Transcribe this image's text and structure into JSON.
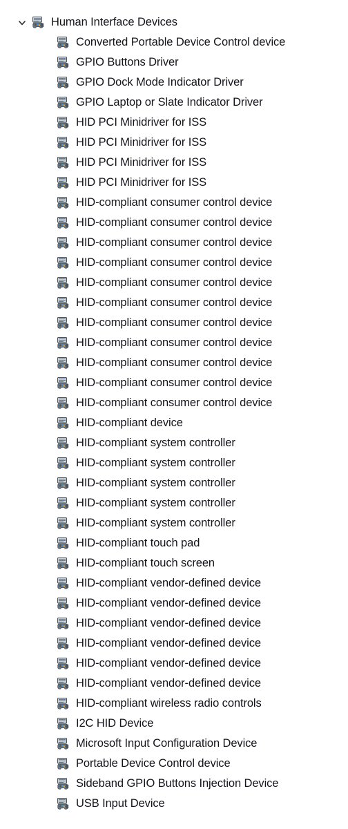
{
  "window": {
    "app": "Device Manager",
    "view": "device-tree"
  },
  "tree": {
    "root": {
      "label": "Human Interface Devices",
      "expand_state": "expanded",
      "chevron_icon": "chevron-down-icon",
      "node_icon": "hid-device-icon"
    },
    "child_icon": "hid-device-icon",
    "children": [
      {
        "label": "Converted Portable Device Control device"
      },
      {
        "label": "GPIO Buttons Driver"
      },
      {
        "label": "GPIO Dock Mode Indicator Driver"
      },
      {
        "label": "GPIO Laptop or Slate Indicator Driver"
      },
      {
        "label": "HID PCI Minidriver for ISS"
      },
      {
        "label": "HID PCI Minidriver for ISS"
      },
      {
        "label": "HID PCI Minidriver for ISS"
      },
      {
        "label": "HID PCI Minidriver for ISS"
      },
      {
        "label": "HID-compliant consumer control device"
      },
      {
        "label": "HID-compliant consumer control device"
      },
      {
        "label": "HID-compliant consumer control device"
      },
      {
        "label": "HID-compliant consumer control device"
      },
      {
        "label": "HID-compliant consumer control device"
      },
      {
        "label": "HID-compliant consumer control device"
      },
      {
        "label": "HID-compliant consumer control device"
      },
      {
        "label": "HID-compliant consumer control device"
      },
      {
        "label": "HID-compliant consumer control device"
      },
      {
        "label": "HID-compliant consumer control device"
      },
      {
        "label": "HID-compliant consumer control device"
      },
      {
        "label": "HID-compliant device"
      },
      {
        "label": "HID-compliant system controller"
      },
      {
        "label": "HID-compliant system controller"
      },
      {
        "label": "HID-compliant system controller"
      },
      {
        "label": "HID-compliant system controller"
      },
      {
        "label": "HID-compliant system controller"
      },
      {
        "label": "HID-compliant touch pad"
      },
      {
        "label": "HID-compliant touch screen"
      },
      {
        "label": "HID-compliant vendor-defined device"
      },
      {
        "label": "HID-compliant vendor-defined device"
      },
      {
        "label": "HID-compliant vendor-defined device"
      },
      {
        "label": "HID-compliant vendor-defined device"
      },
      {
        "label": "HID-compliant vendor-defined device"
      },
      {
        "label": "HID-compliant vendor-defined device"
      },
      {
        "label": "HID-compliant wireless radio controls"
      },
      {
        "label": "I2C HID Device"
      },
      {
        "label": "Microsoft Input Configuration Device"
      },
      {
        "label": "Portable Device Control device"
      },
      {
        "label": "Sideband GPIO Buttons Injection Device"
      },
      {
        "label": "USB Input Device"
      }
    ]
  },
  "colors": {
    "background": "#ffffff",
    "text": "#14141b",
    "icon_body": "#6e7a85",
    "icon_shadow": "#4a535c",
    "icon_screen": "#c9d2d8",
    "icon_accent_blue": "#2f9fe0",
    "icon_accent_orange": "#f0a030",
    "chevron": "#2b2b2b"
  }
}
